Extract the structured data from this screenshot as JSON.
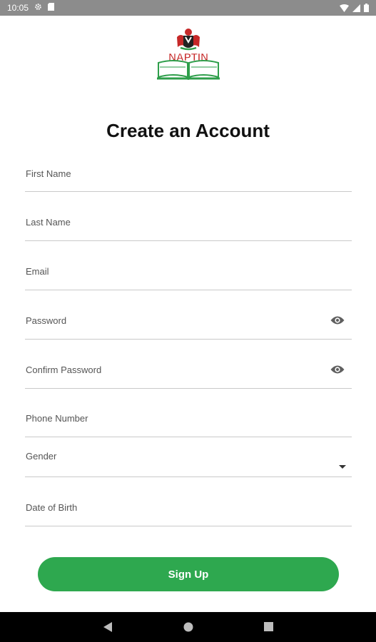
{
  "status_bar": {
    "time": "10:05",
    "icons": [
      "settings-icon",
      "sd-card-icon",
      "wifi-icon",
      "signal-icon",
      "battery-icon"
    ]
  },
  "logo": {
    "text": "NAPTIN"
  },
  "title": "Create an Account",
  "form": {
    "first_name": {
      "label": "First Name"
    },
    "last_name": {
      "label": "Last Name"
    },
    "email": {
      "label": "Email"
    },
    "password": {
      "label": "Password",
      "icon": "eye-icon"
    },
    "confirm_password": {
      "label": "Confirm Password",
      "icon": "eye-icon"
    },
    "phone": {
      "label": "Phone Number"
    },
    "gender": {
      "label": "Gender",
      "icon": "dropdown-arrow-icon"
    },
    "dob": {
      "label": "Date of Birth"
    }
  },
  "signup_button": {
    "label": "Sign Up"
  },
  "colors": {
    "accent": "#2ea84f",
    "logo_red": "#c62828",
    "logo_green": "#2e9e4a"
  },
  "nav_bar": {
    "icons": [
      "back-icon",
      "home-icon",
      "recents-icon"
    ]
  }
}
